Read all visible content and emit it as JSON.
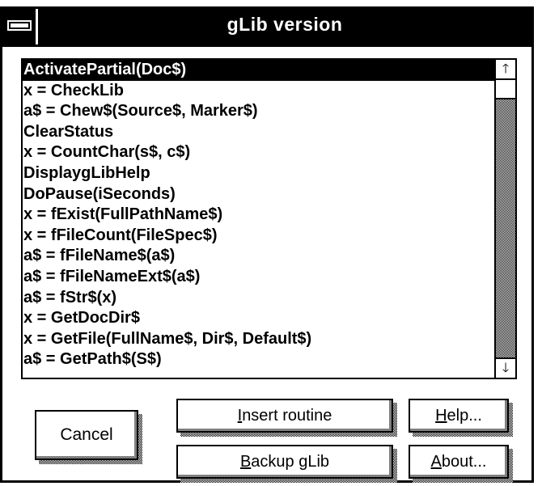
{
  "window": {
    "title": "gLib version"
  },
  "routines": {
    "selected_index": 0,
    "items": [
      "ActivatePartial(Doc$)",
      "x = CheckLib",
      "a$ = Chew$(Source$, Marker$)",
      "ClearStatus",
      "x = CountChar(s$, c$)",
      "DisplaygLibHelp",
      "DoPause(iSeconds)",
      "x = fExist(FullPathName$)",
      "x = fFileCount(FileSpec$)",
      "a$ = fFileName$(a$)",
      "a$ = fFileNameExt$(a$)",
      "a$ = fStr$(x)",
      "x = GetDocDir$",
      "x = GetFile(FullName$, Dir$, Default$)",
      "a$ = GetPath$(S$)"
    ]
  },
  "scrollbar": {
    "up_icon": "arrow-up-icon",
    "down_icon": "arrow-down-icon",
    "up_glyph": "🡑",
    "down_glyph": "🡓"
  },
  "buttons": {
    "cancel": "Cancel",
    "insert_routine": {
      "mnemonic": "I",
      "rest": "nsert routine"
    },
    "backup_glib": {
      "mnemonic": "B",
      "rest": "ackup gLib"
    },
    "help": {
      "mnemonic": "H",
      "rest": "elp..."
    },
    "about": {
      "mnemonic": "A",
      "rest": "bout..."
    }
  },
  "colors": {
    "titlebar": "#000000",
    "selection": "#000000",
    "background": "#ffffff"
  }
}
